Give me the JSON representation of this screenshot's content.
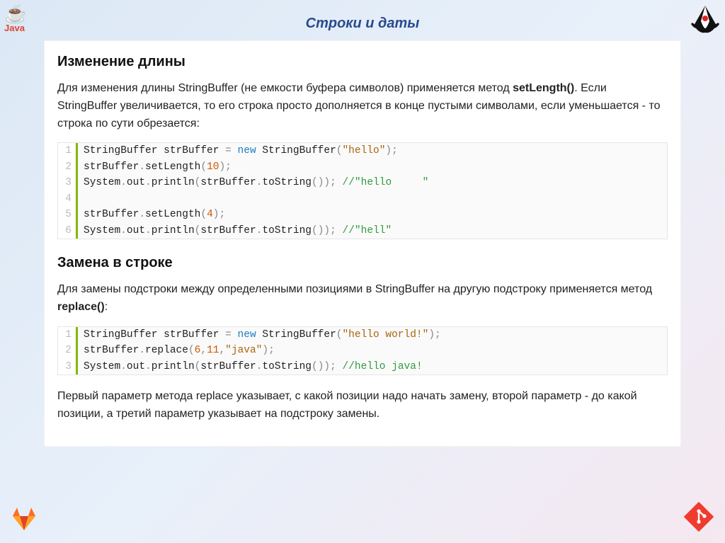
{
  "slideTitle": "Строки и даты",
  "icons": {
    "javaText": "Java",
    "javaCup": "☕",
    "duke": "duke-mascot-icon",
    "gitlab": "gitlab-icon",
    "git": "git-icon"
  },
  "section1": {
    "heading": "Изменение длины",
    "para_before_bold": "Для изменения длины StringBuffer (не емкости буфера символов) применяется метод ",
    "bold": "setLength()",
    "para_after_bold": ". Если StringBuffer увеличивается, то его строка просто дополняется в конце пустыми символами, если уменьшается - то строка по сути обрезается:"
  },
  "code1": [
    [
      {
        "t": "StringBuffer strBuffer ",
        "c": ""
      },
      {
        "t": "=",
        "c": "tok-punc"
      },
      {
        "t": " ",
        "c": ""
      },
      {
        "t": "new",
        "c": "tok-kw"
      },
      {
        "t": " StringBuffer",
        "c": ""
      },
      {
        "t": "(",
        "c": "tok-punc"
      },
      {
        "t": "\"hello\"",
        "c": "tok-str"
      },
      {
        "t": ");",
        "c": "tok-punc"
      }
    ],
    [
      {
        "t": "strBuffer",
        "c": ""
      },
      {
        "t": ".",
        "c": "tok-punc"
      },
      {
        "t": "setLength",
        "c": ""
      },
      {
        "t": "(",
        "c": "tok-punc"
      },
      {
        "t": "10",
        "c": "tok-num"
      },
      {
        "t": ");",
        "c": "tok-punc"
      }
    ],
    [
      {
        "t": "System",
        "c": ""
      },
      {
        "t": ".",
        "c": "tok-punc"
      },
      {
        "t": "out",
        "c": ""
      },
      {
        "t": ".",
        "c": "tok-punc"
      },
      {
        "t": "println",
        "c": ""
      },
      {
        "t": "(",
        "c": "tok-punc"
      },
      {
        "t": "strBuffer",
        "c": ""
      },
      {
        "t": ".",
        "c": "tok-punc"
      },
      {
        "t": "toString",
        "c": ""
      },
      {
        "t": "());",
        "c": "tok-punc"
      },
      {
        "t": " ",
        "c": ""
      },
      {
        "t": "//\"hello     \"",
        "c": "tok-cmt"
      }
    ],
    [],
    [
      {
        "t": "strBuffer",
        "c": ""
      },
      {
        "t": ".",
        "c": "tok-punc"
      },
      {
        "t": "setLength",
        "c": ""
      },
      {
        "t": "(",
        "c": "tok-punc"
      },
      {
        "t": "4",
        "c": "tok-num"
      },
      {
        "t": ");",
        "c": "tok-punc"
      }
    ],
    [
      {
        "t": "System",
        "c": ""
      },
      {
        "t": ".",
        "c": "tok-punc"
      },
      {
        "t": "out",
        "c": ""
      },
      {
        "t": ".",
        "c": "tok-punc"
      },
      {
        "t": "println",
        "c": ""
      },
      {
        "t": "(",
        "c": "tok-punc"
      },
      {
        "t": "strBuffer",
        "c": ""
      },
      {
        "t": ".",
        "c": "tok-punc"
      },
      {
        "t": "toString",
        "c": ""
      },
      {
        "t": "());",
        "c": "tok-punc"
      },
      {
        "t": " ",
        "c": ""
      },
      {
        "t": "//\"hell\"",
        "c": "tok-cmt"
      }
    ]
  ],
  "section2": {
    "heading": "Замена в строке",
    "para_before_bold": "Для замены подстроки между определенными позициями в StringBuffer на другую подстроку применяется метод ",
    "bold": "replace()",
    "para_after_bold": ":"
  },
  "code2": [
    [
      {
        "t": "StringBuffer strBuffer ",
        "c": ""
      },
      {
        "t": "=",
        "c": "tok-punc"
      },
      {
        "t": " ",
        "c": ""
      },
      {
        "t": "new",
        "c": "tok-kw"
      },
      {
        "t": " StringBuffer",
        "c": ""
      },
      {
        "t": "(",
        "c": "tok-punc"
      },
      {
        "t": "\"hello world!\"",
        "c": "tok-str"
      },
      {
        "t": ");",
        "c": "tok-punc"
      }
    ],
    [
      {
        "t": "strBuffer",
        "c": ""
      },
      {
        "t": ".",
        "c": "tok-punc"
      },
      {
        "t": "replace",
        "c": ""
      },
      {
        "t": "(",
        "c": "tok-punc"
      },
      {
        "t": "6",
        "c": "tok-num"
      },
      {
        "t": ",",
        "c": "tok-punc"
      },
      {
        "t": "11",
        "c": "tok-num"
      },
      {
        "t": ",",
        "c": "tok-punc"
      },
      {
        "t": "\"java\"",
        "c": "tok-str"
      },
      {
        "t": ");",
        "c": "tok-punc"
      }
    ],
    [
      {
        "t": "System",
        "c": ""
      },
      {
        "t": ".",
        "c": "tok-punc"
      },
      {
        "t": "out",
        "c": ""
      },
      {
        "t": ".",
        "c": "tok-punc"
      },
      {
        "t": "println",
        "c": ""
      },
      {
        "t": "(",
        "c": "tok-punc"
      },
      {
        "t": "strBuffer",
        "c": ""
      },
      {
        "t": ".",
        "c": "tok-punc"
      },
      {
        "t": "toString",
        "c": ""
      },
      {
        "t": "());",
        "c": "tok-punc"
      },
      {
        "t": " ",
        "c": ""
      },
      {
        "t": "//hello java!",
        "c": "tok-cmt"
      }
    ]
  ],
  "footerPara": "Первый параметр метода replace указывает, с какой позиции надо начать замену, второй параметр - до какой позиции, а третий параметр указывает на подстроку замены."
}
